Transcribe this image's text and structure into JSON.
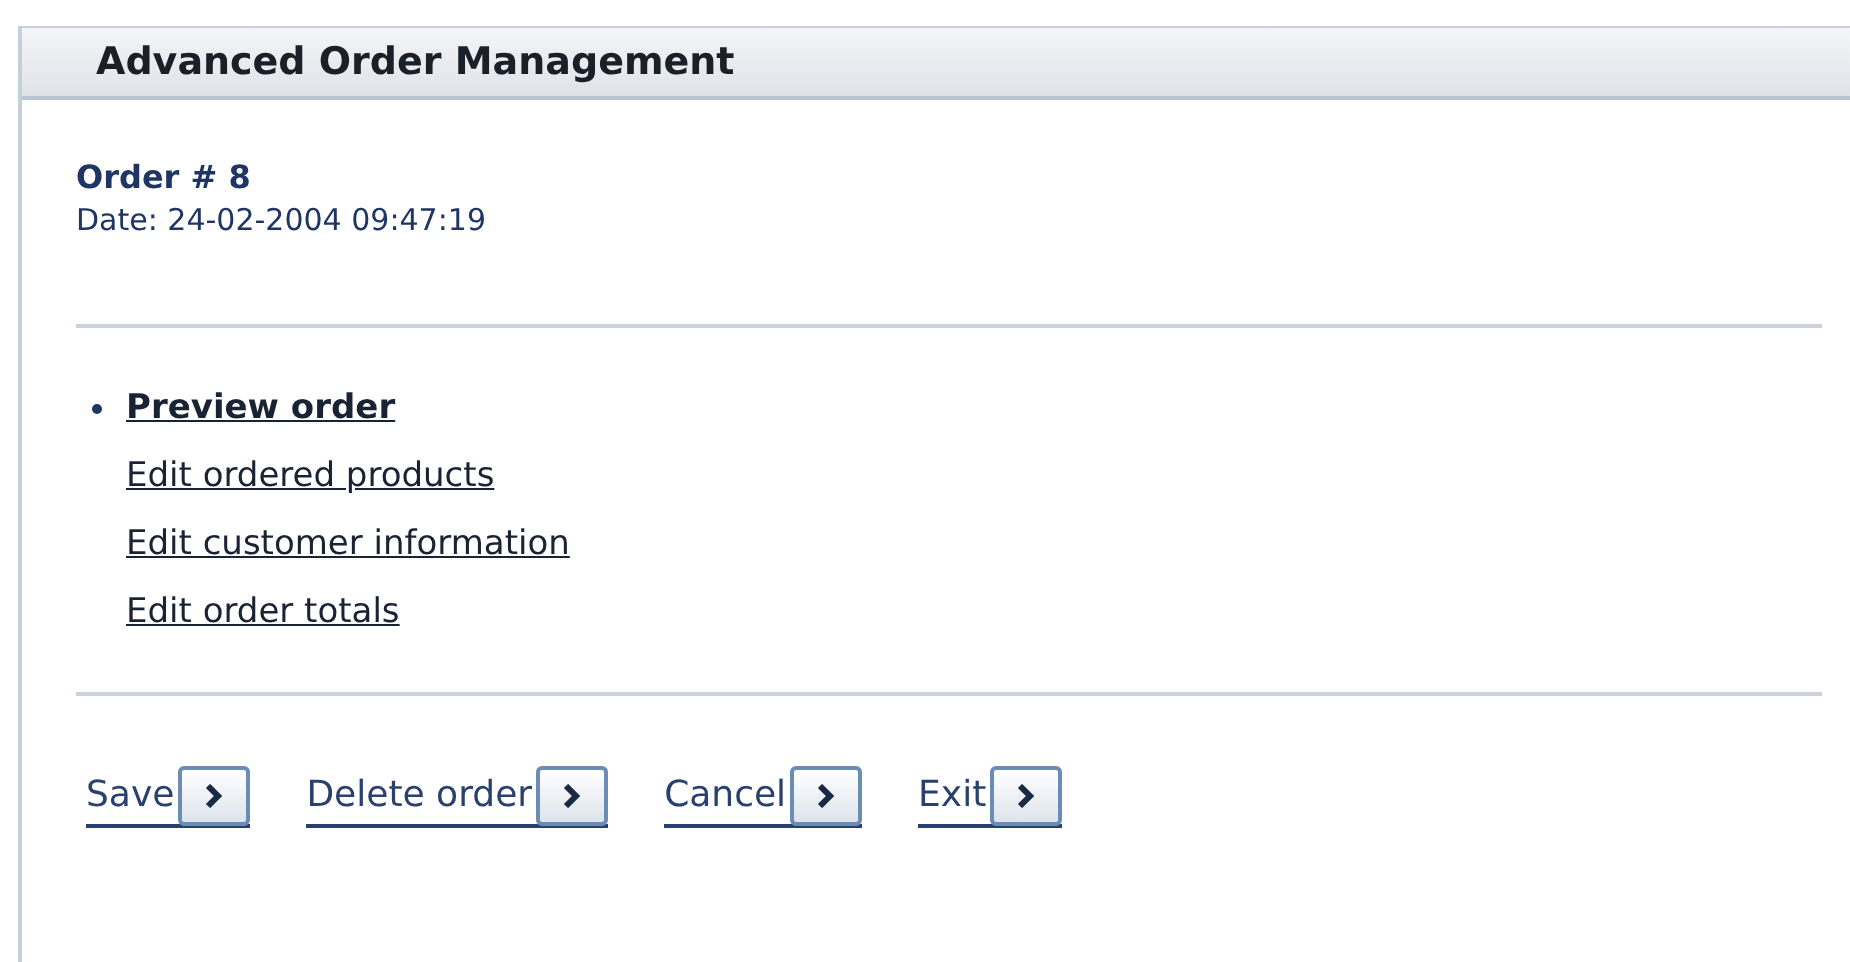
{
  "header": {
    "title": "Advanced Order Management"
  },
  "order": {
    "title": "Order # 8",
    "date": "Date: 24-02-2004  09:47:19"
  },
  "menu": [
    {
      "label": "Preview order",
      "selected": true
    },
    {
      "label": "Edit ordered products",
      "selected": false
    },
    {
      "label": "Edit customer information",
      "selected": false
    },
    {
      "label": "Edit order totals",
      "selected": false
    }
  ],
  "buttons": [
    "Save",
    "Delete order",
    "Cancel",
    "Exit"
  ]
}
